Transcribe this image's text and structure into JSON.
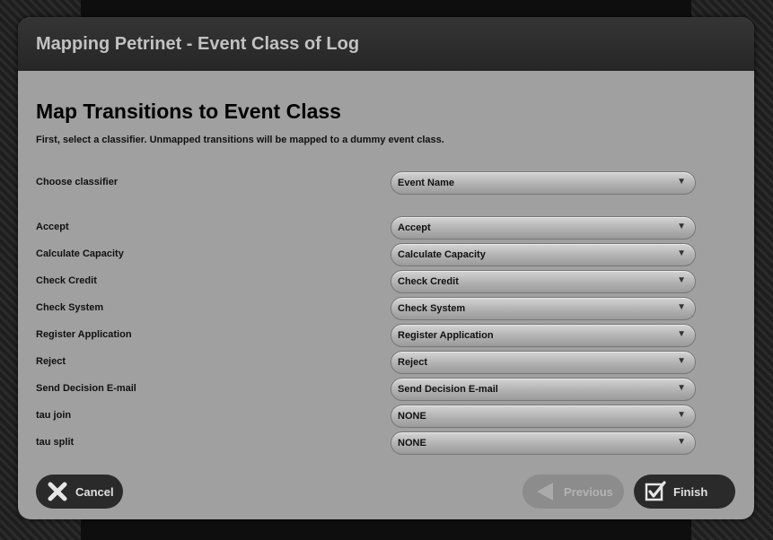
{
  "dialog": {
    "title": "Mapping Petrinet - Event Class of Log",
    "heading": "Map Transitions to Event Class",
    "subtitle": "First, select a classifier. Unmapped transitions will be mapped to a dummy event class.",
    "classifier": {
      "label": "Choose classifier",
      "value": "Event Name"
    },
    "mappings": [
      {
        "label": "Accept",
        "value": "Accept"
      },
      {
        "label": "Calculate Capacity",
        "value": "Calculate Capacity"
      },
      {
        "label": "Check Credit",
        "value": "Check Credit"
      },
      {
        "label": "Check System",
        "value": "Check System"
      },
      {
        "label": "Register Application",
        "value": "Register Application"
      },
      {
        "label": "Reject",
        "value": "Reject"
      },
      {
        "label": "Send Decision E-mail",
        "value": "Send Decision E-mail"
      },
      {
        "label": "tau join",
        "value": "NONE"
      },
      {
        "label": "tau split",
        "value": "NONE"
      }
    ],
    "buttons": {
      "cancel": "Cancel",
      "previous": "Previous",
      "finish": "Finish"
    }
  }
}
